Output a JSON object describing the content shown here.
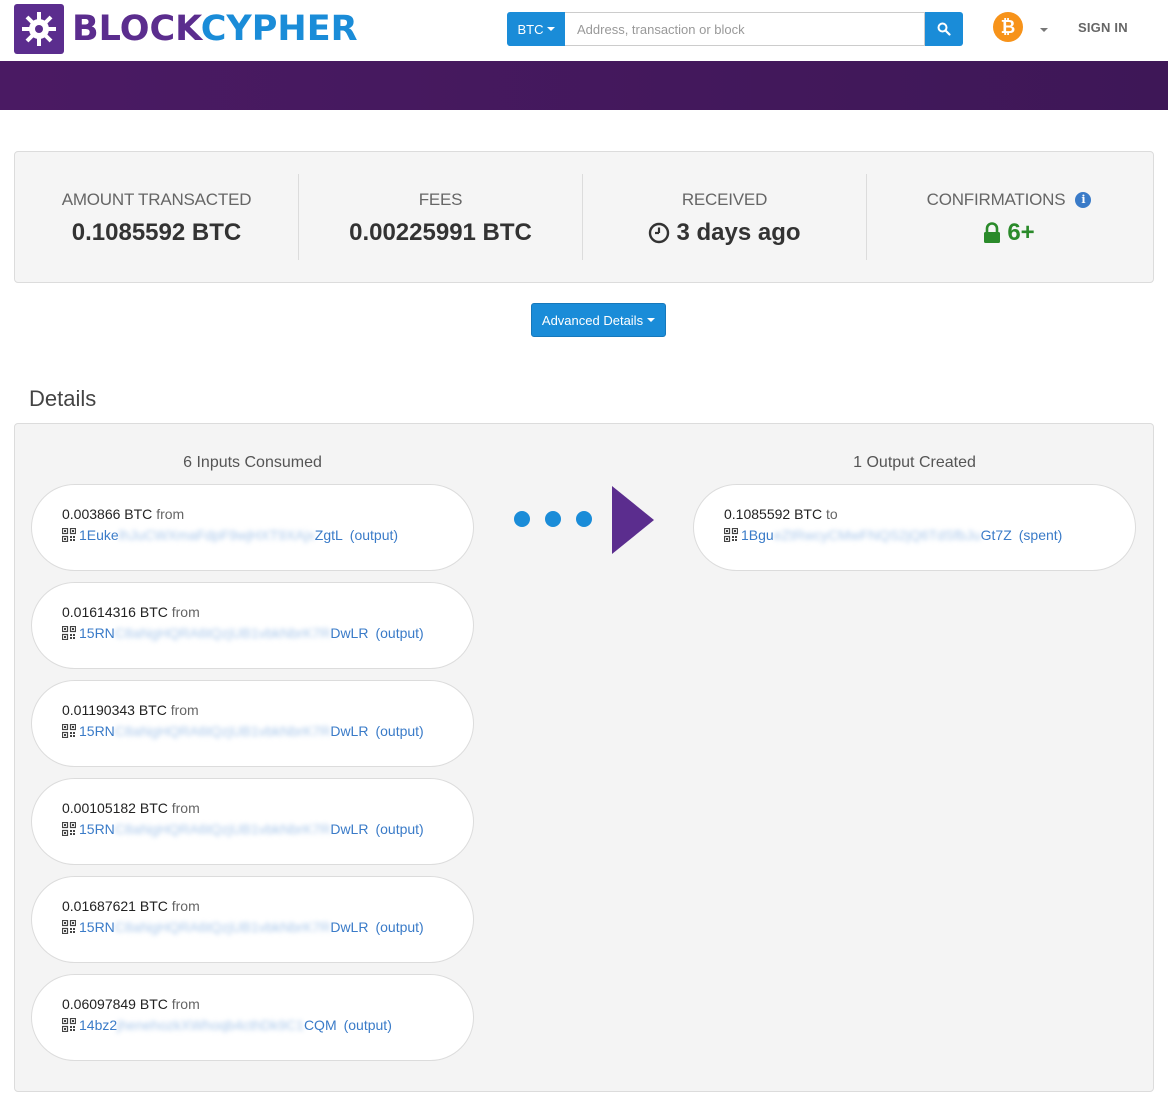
{
  "header": {
    "logo_part1": "BLOCK",
    "logo_part2": "CYPHER",
    "coin_selector": "BTC",
    "search_placeholder": "Address, transaction or block",
    "coin_symbol": "₿",
    "signin": "SIGN IN"
  },
  "summary": {
    "amount_label": "AMOUNT TRANSACTED",
    "amount_value": "0.1085592 BTC",
    "fees_label": "FEES",
    "fees_value": "0.00225991 BTC",
    "received_label": "RECEIVED",
    "received_value": "3 days ago",
    "confirmations_label": "CONFIRMATIONS",
    "confirmations_value": "6+"
  },
  "advanced_details_label": "Advanced Details",
  "details_title": "Details",
  "inputs_heading": "6 Inputs Consumed",
  "outputs_heading": "1 Output Created",
  "inputs": [
    {
      "amount": "0.003866 BTC",
      "direction": "from",
      "addr_start": "1Euke",
      "addr_hidden": "lhJuCWXmaFdpF9wjHXT9XAjx",
      "addr_end": "ZgtL",
      "tag": "(output)"
    },
    {
      "amount": "0.01614316 BTC",
      "direction": "from",
      "addr_start": "15RN",
      "addr_hidden": "C8aNgHQRA6tQzjUB1vbkNbrK7R",
      "addr_end": "DwLR",
      "tag": "(output)"
    },
    {
      "amount": "0.01190343 BTC",
      "direction": "from",
      "addr_start": "15RN",
      "addr_hidden": "C8aNgHQRA6tQzjUB1vbkNbrK7R",
      "addr_end": "DwLR",
      "tag": "(output)"
    },
    {
      "amount": "0.00105182 BTC",
      "direction": "from",
      "addr_start": "15RN",
      "addr_hidden": "C8aNgHQRA6tQzjUB1vbkNbrK7R",
      "addr_end": "DwLR",
      "tag": "(output)"
    },
    {
      "amount": "0.01687621 BTC",
      "direction": "from",
      "addr_start": "15RN",
      "addr_hidden": "C8aNgHQRA6tQzjUB1vbkNbrK7R",
      "addr_end": "DwLR",
      "tag": "(output)"
    },
    {
      "amount": "0.06097849 BTC",
      "direction": "from",
      "addr_start": "14bz2",
      "addr_hidden": "jhenehozkXWhoqb4cthDk9C1",
      "addr_end": "CQM",
      "tag": "(output)"
    }
  ],
  "outputs": [
    {
      "amount": "0.1085592 BTC",
      "direction": "to",
      "addr_start": "1Bgu",
      "addr_hidden": "eZtRwcyCMwFNQS2jQ6TdSfbJu",
      "addr_end": "Gt7Z",
      "tag": "(spent)"
    }
  ],
  "colors": {
    "brand_purple": "#5b2d8e",
    "accent_blue": "#1a8cd8",
    "confirm_green": "#2a8a2a",
    "bitcoin_orange": "#f7931a"
  }
}
